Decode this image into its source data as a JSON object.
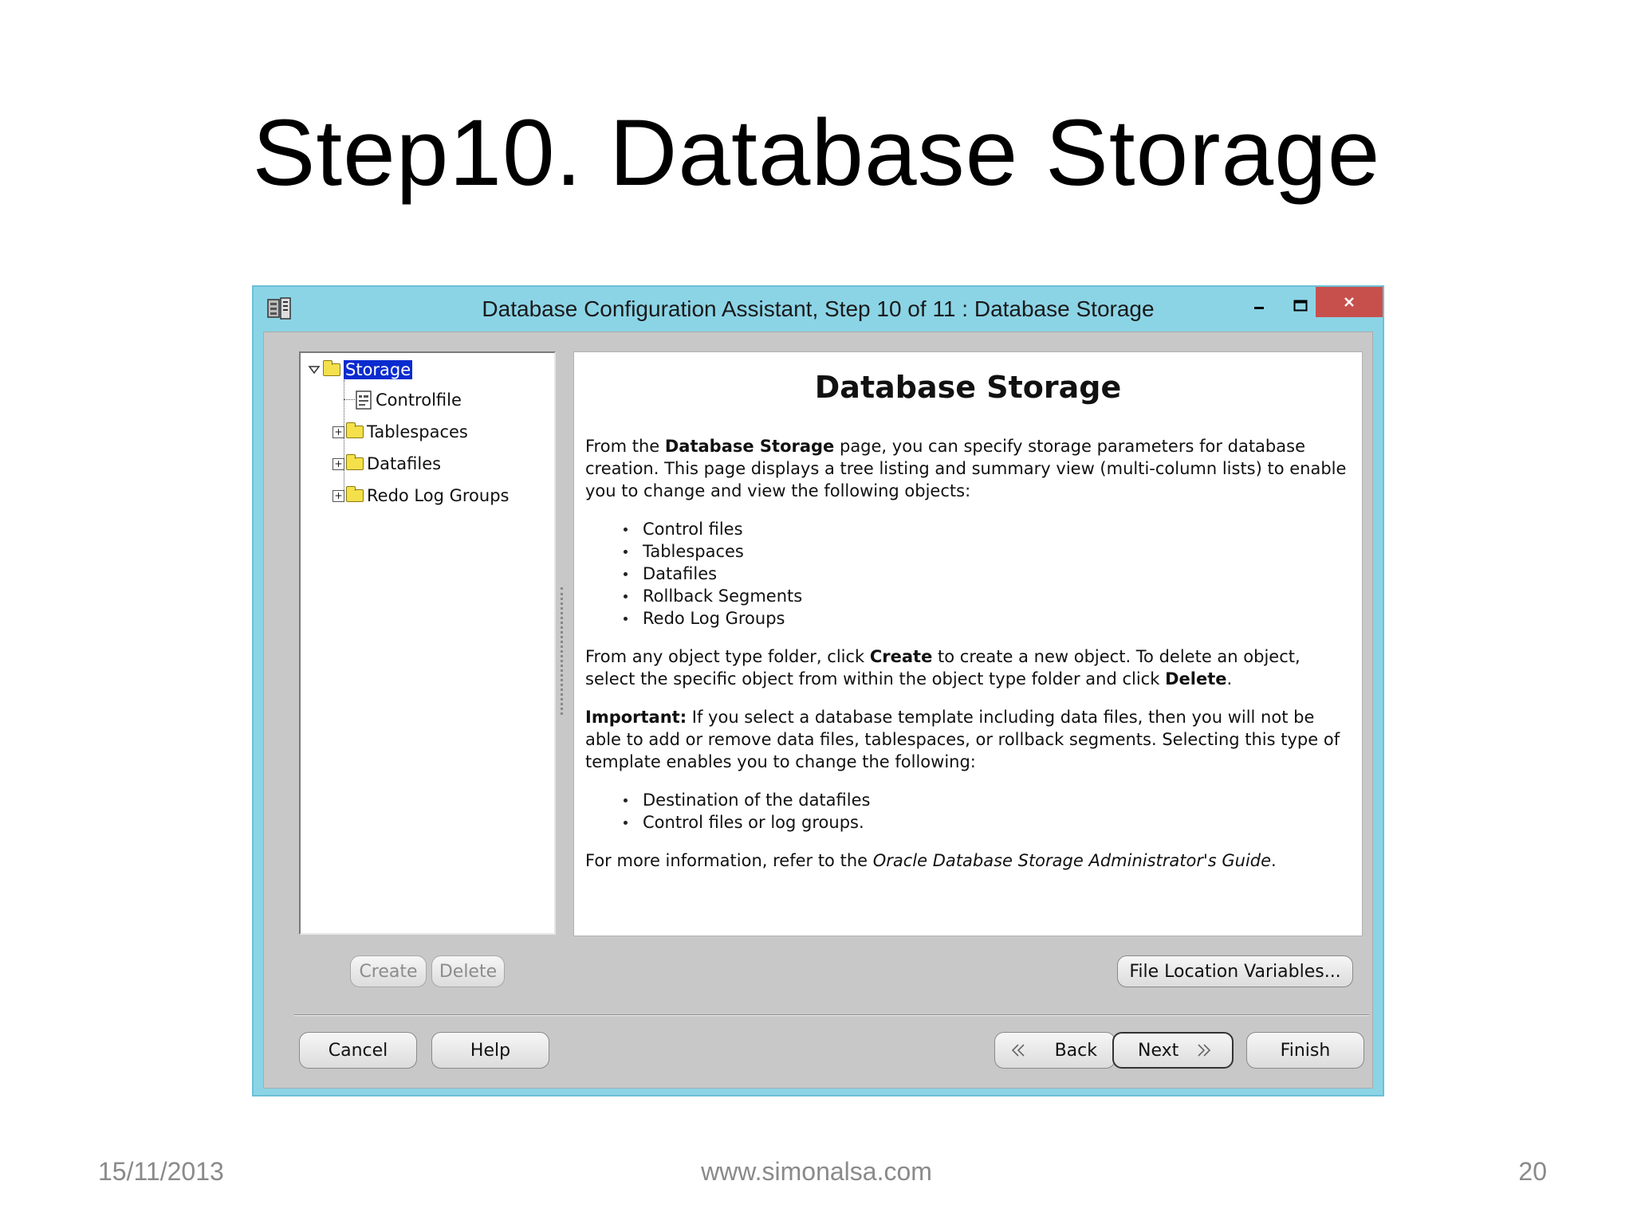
{
  "slide": {
    "title": "Step10. Database Storage",
    "footer_date": "15/11/2013",
    "footer_url": "www.simonalsa.com",
    "footer_page": "20"
  },
  "window": {
    "title": "Database Configuration Assistant, Step 10 of 11 : Database Storage",
    "icons": {
      "app": "database-app-icon",
      "minimize": "minimize-icon",
      "maximize": "maximize-icon",
      "close": "close-icon"
    },
    "colors": {
      "titlebar": "#8bd4e6",
      "close": "#c7504d",
      "selection": "#0a2bcf"
    }
  },
  "tree": {
    "root": "Storage",
    "children": [
      "Controlfile",
      "Tablespaces",
      "Datafiles",
      "Redo Log Groups"
    ]
  },
  "content": {
    "heading": "Database Storage",
    "p1_a": "From the ",
    "p1_b": "Database Storage",
    "p1_c": " page, you can specify storage parameters for database creation. This page displays a tree listing and summary view (multi-column lists) to enable you to change and view the following objects:",
    "list1": [
      "Control files",
      "Tablespaces",
      "Datafiles",
      "Rollback Segments",
      "Redo Log Groups"
    ],
    "p2_a": "From any object type folder, click ",
    "p2_b": "Create",
    "p2_c": " to create a new object. To delete an object, select the specific object from within the object type folder and click ",
    "p2_d": "Delete",
    "p2_e": ".",
    "p3_a": "Important:",
    "p3_b": " If you select a database template including data files, then you will not be able to add or remove data files, tablespaces, or rollback segments. Selecting this type of template enables you to change the following:",
    "list2": [
      "Destination of the datafiles",
      "Control files or log groups."
    ],
    "p4_a": "For more information, refer to the ",
    "p4_b": "Oracle Database Storage Administrator's Guide",
    "p4_c": "."
  },
  "buttons": {
    "create": "Create",
    "delete": "Delete",
    "file_location": "File Location Variables...",
    "cancel": "Cancel",
    "help": "Help",
    "back": "Back",
    "next": "Next",
    "finish": "Finish"
  }
}
